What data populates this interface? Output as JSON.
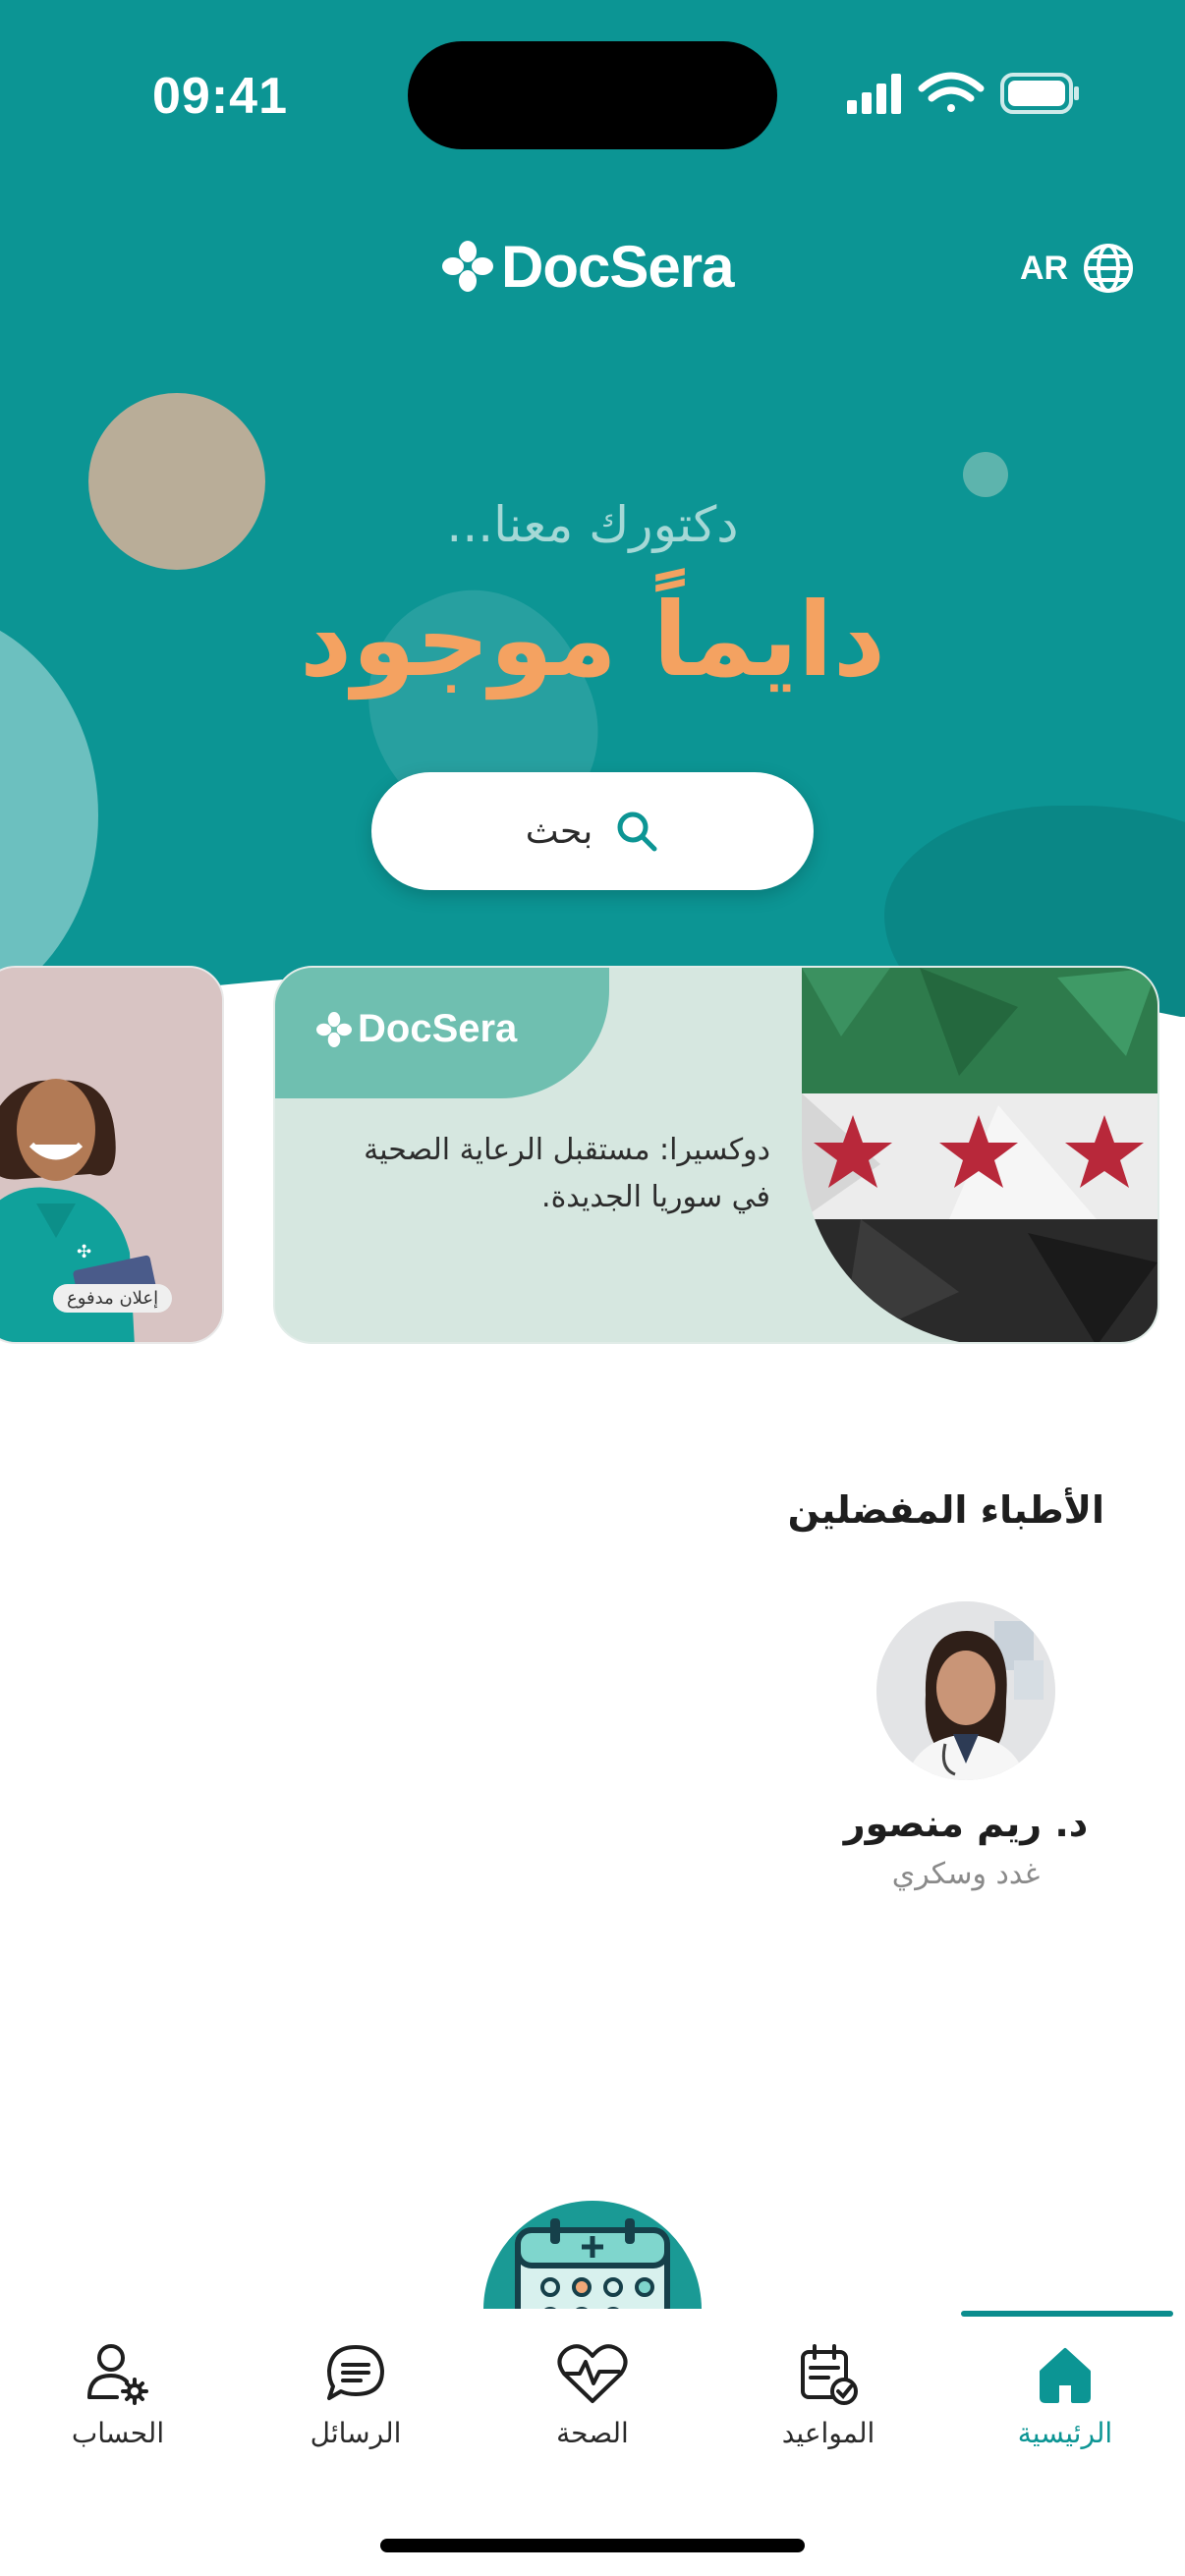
{
  "status_bar": {
    "time": "09:41"
  },
  "header": {
    "brand": "DocSera",
    "language": "AR",
    "tagline": "دكتورك معنا...",
    "headline": "دايماً موجود",
    "search_label": "بحث"
  },
  "carousel": {
    "ad_badge": "إعلان مدفوع",
    "main_card": {
      "brand": "DocSera",
      "text_line1": "دوكسيرا: مستقبل الرعاية الصحية",
      "text_line2": "في سوريا الجديدة."
    }
  },
  "favorites": {
    "title": "الأطباء المفضلين",
    "doctors": [
      {
        "name": "د. ريم منصور",
        "specialty": "غدد وسكري"
      }
    ]
  },
  "bottom_nav": {
    "items": [
      {
        "label": "الرئيسية",
        "icon": "home-icon",
        "active": true
      },
      {
        "label": "المواعيد",
        "icon": "calendar-check-icon",
        "active": false
      },
      {
        "label": "الصحة",
        "icon": "heart-pulse-icon",
        "active": false
      },
      {
        "label": "الرسائل",
        "icon": "chat-bubble-icon",
        "active": false
      },
      {
        "label": "الحساب",
        "icon": "user-settings-icon",
        "active": false
      }
    ]
  },
  "colors": {
    "primary": "#0c9594",
    "accent": "#f4a261",
    "tagline": "#a5d8d6"
  }
}
